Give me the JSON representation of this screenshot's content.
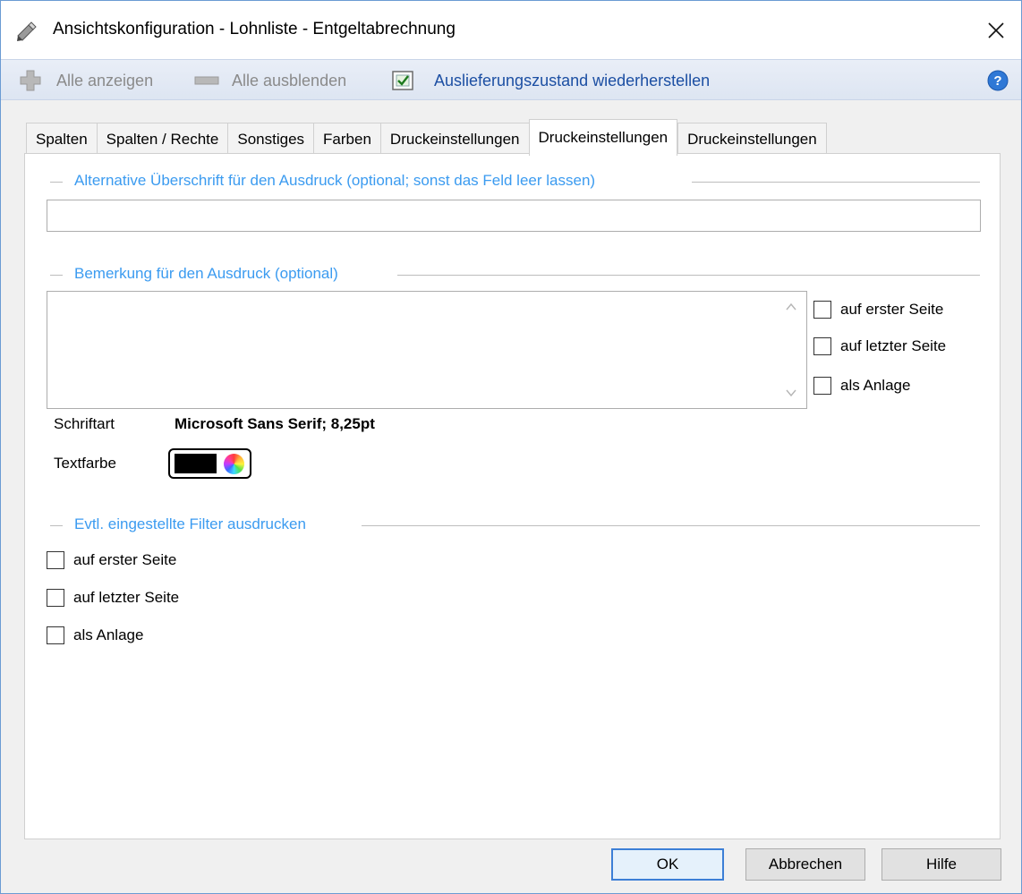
{
  "window": {
    "title": "Ansichtskonfiguration - Lohnliste - Entgeltabrechnung",
    "title_icon": "pencil-tool-icon",
    "close_icon": "close-icon"
  },
  "toolbar": {
    "show_all_label": "Alle anzeigen",
    "hide_all_label": "Alle ausblenden",
    "restore_label": "Auslieferungszustand wiederherstellen",
    "help_icon": "help-icon"
  },
  "tabs": [
    {
      "label": "Spalten",
      "active": false
    },
    {
      "label": "Spalten / Rechte",
      "active": false
    },
    {
      "label": "Sonstiges",
      "active": false
    },
    {
      "label": "Farben",
      "active": false
    },
    {
      "label": "Druckeinstellungen",
      "active": false
    },
    {
      "label": "Druckeinstellungen",
      "active": true
    },
    {
      "label": "Druckeinstellungen",
      "active": false
    }
  ],
  "heading_section": {
    "title": "Alternative Überschrift für den Ausdruck (optional; sonst das Feld leer lassen)",
    "value": ""
  },
  "remark_section": {
    "title": "Bemerkung für den Ausdruck (optional)",
    "value": "",
    "options": [
      {
        "label": "auf erster Seite",
        "checked": false
      },
      {
        "label": "auf letzter Seite",
        "checked": false
      },
      {
        "label": "als Anlage",
        "checked": false
      }
    ],
    "font_label": "Schriftart",
    "font_value": "Microsoft Sans Serif; 8,25pt",
    "color_label": "Textfarbe",
    "color_value": "#000000"
  },
  "filter_section": {
    "title": "Evtl. eingestellte Filter ausdrucken",
    "options": [
      {
        "label": "auf erster Seite",
        "checked": false
      },
      {
        "label": "auf letzter Seite",
        "checked": false
      },
      {
        "label": "als Anlage",
        "checked": false
      }
    ]
  },
  "buttons": {
    "ok": "OK",
    "cancel": "Abbrechen",
    "help": "Hilfe"
  },
  "colors": {
    "accent": "#3b9bf0",
    "toolbar_link": "#1c4fa3",
    "border": "#6b9bd3"
  }
}
